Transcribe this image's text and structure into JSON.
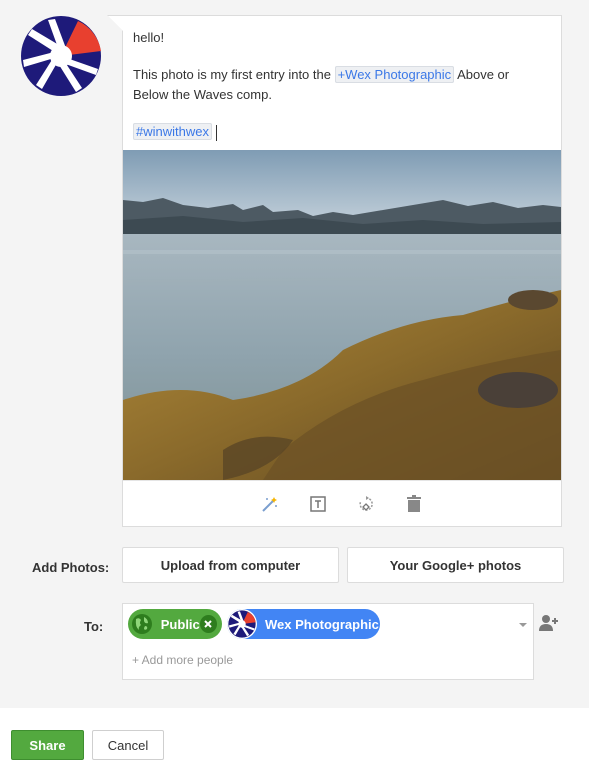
{
  "post": {
    "line1": "hello!",
    "line2_prefix": "This photo is my first entry into the ",
    "mention": "+Wex Photographic",
    "line2_suffix": " Above or",
    "line3": "Below the Waves comp.",
    "hashtag": "#winwithwex"
  },
  "photo_tools": [
    "auto-enhance-icon",
    "text-caption-icon",
    "rotate-icon",
    "trash-icon"
  ],
  "add_photos": {
    "label": "Add Photos:",
    "upload_label": "Upload from computer",
    "google_label": "Your Google+ photos"
  },
  "share_to": {
    "label": "To:",
    "chips": [
      {
        "label": "Public",
        "color": "#53a93f"
      },
      {
        "label": "Wex Photographic",
        "color": "#4285f4"
      }
    ],
    "add_more_placeholder": "+ Add more people"
  },
  "actions": {
    "share_label": "Share",
    "cancel_label": "Cancel"
  },
  "colors": {
    "logo_navy": "#1e1a7a",
    "logo_red": "#e8402f",
    "share_green": "#53a93f",
    "chip_blue": "#4285f4",
    "link_blue": "#3b78e7"
  }
}
